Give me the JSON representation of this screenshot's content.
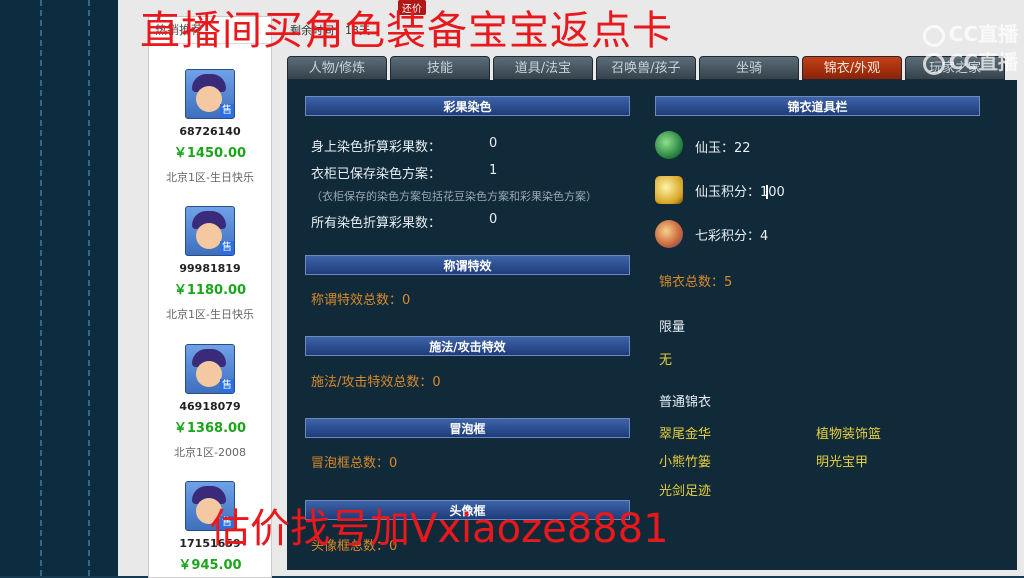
{
  "overlay": {
    "top_text": "直播间买角色装备宝宝返点卡",
    "bottom_text": "估价找号加Vxiaoze8881",
    "logo_text_1": "CC直播",
    "logo_text_2": "CC直播"
  },
  "list_panel": {
    "header": "热销推荐",
    "sellers": [
      {
        "id": "68726140",
        "price": "￥1450.00",
        "server": "北京1区-生日快乐",
        "tag": "售"
      },
      {
        "id": "99981819",
        "price": "￥1180.00",
        "server": "北京1区-生日快乐",
        "tag": "售"
      },
      {
        "id": "46918079",
        "price": "￥1368.00",
        "server": "北京1区-2008",
        "tag": "售"
      },
      {
        "id": "17151659",
        "price": "￥945.00",
        "server": "",
        "tag": "售"
      }
    ]
  },
  "mid_top": {
    "line1": "",
    "badge": "还价",
    "line2": "剩余时间：13天"
  },
  "tabs": [
    {
      "label": "人物/修炼"
    },
    {
      "label": "技能"
    },
    {
      "label": "道具/法宝"
    },
    {
      "label": "召唤兽/孩子"
    },
    {
      "label": "坐骑"
    },
    {
      "label": "锦衣/外观"
    },
    {
      "label": "玩家之家"
    }
  ],
  "left_col": {
    "dye_head": "彩果染色",
    "dye_rows": [
      {
        "label": "身上染色折算彩果数：",
        "value": "0"
      },
      {
        "label": "衣柜已保存染色方案：",
        "value": "1"
      }
    ],
    "dye_note": "（衣柜保存的染色方案包括花豆染色方案和彩果染色方案）",
    "dye_total_label": "所有染色折算彩果数：",
    "dye_total_value": "0",
    "title_head": "称谓特效",
    "title_total": "称谓特效总数：0",
    "cast_head": "施法/攻击特效",
    "cast_total": "施法/攻击特效总数：0",
    "bubble_head": "冒泡框",
    "bubble_total": "冒泡框总数：0",
    "avatar_head": "头像框",
    "avatar_total": "头像框总数：0"
  },
  "right_col": {
    "head": "锦衣道具栏",
    "jade": "仙玉：22",
    "jade_points": "仙玉积分：100",
    "rainbow_points": "七彩积分：4",
    "total": "锦衣总数：5",
    "limited_label": "限量",
    "limited_value": "无",
    "normal_label": "普通锦衣",
    "normal_items": [
      "翠尾金华",
      "植物装饰篮",
      "小熊竹篓",
      "明光宝甲",
      "光剑足迹"
    ]
  }
}
